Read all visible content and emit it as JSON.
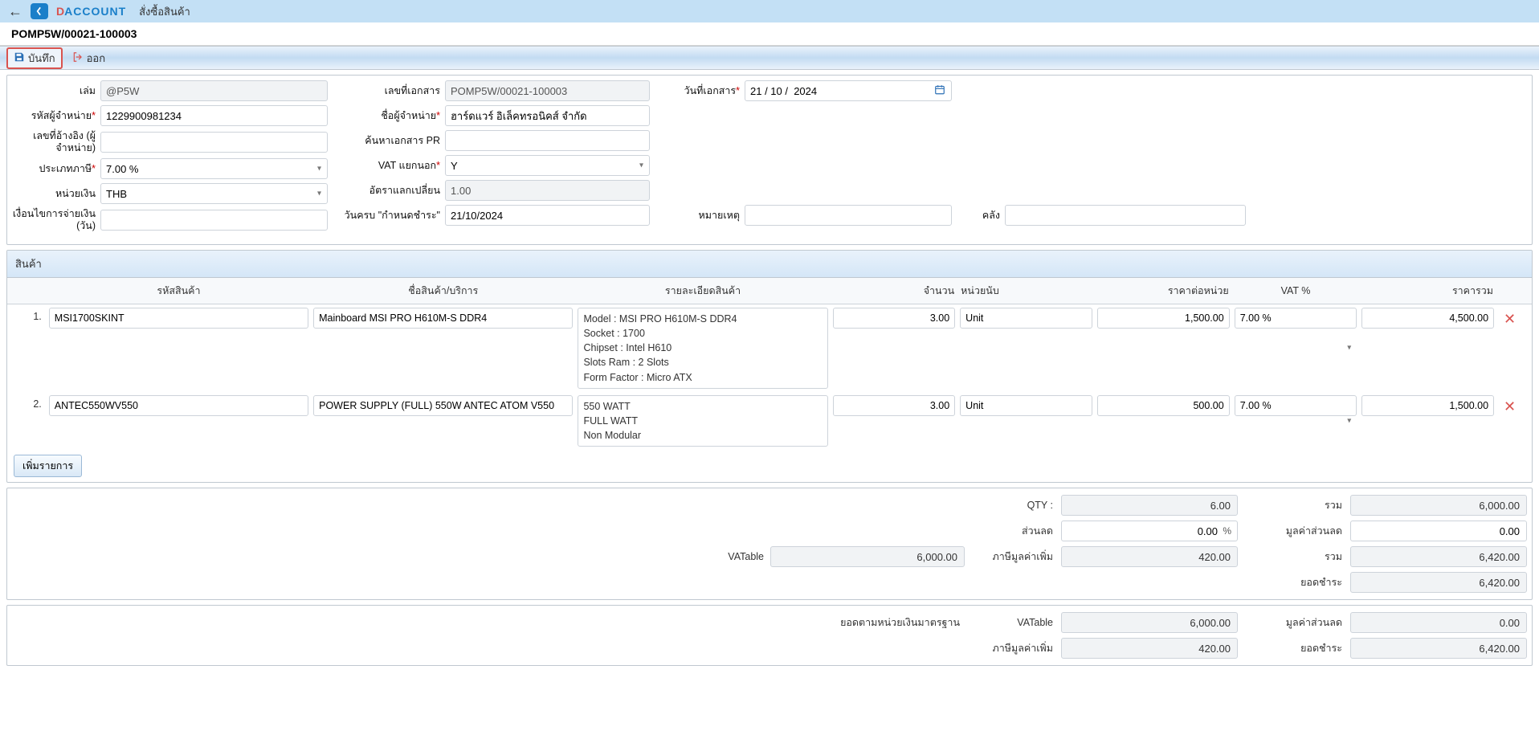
{
  "app": {
    "brand_d": "D",
    "brand_rest": "ACCOUNT",
    "page_title": "สั่งซื้อสินค้า",
    "doc_no": "POMP5W/00021-100003"
  },
  "toolbar": {
    "save_label": "บันทึก",
    "exit_label": "ออก"
  },
  "form": {
    "book_label": "เล่ม",
    "book_value": "@P5W",
    "docno_label": "เลขที่เอกสาร",
    "docno_value": "POMP5W/00021-100003",
    "docdate_label": "วันที่เอกสาร",
    "docdate_value": "21 / 10 /  2024",
    "vendor_code_label": "รหัสผู้จำหน่าย",
    "vendor_code_value": "1229900981234",
    "vendor_name_label": "ชื่อผู้จำหน่าย",
    "vendor_name_value": "ฮาร์ดแวร์ อิเล็คทรอนิคส์ จำกัด",
    "ref_label": "เลขที่อ้างอิง (ผู้จำหน่าย)",
    "ref_value": "",
    "pr_search_label": "ค้นหาเอกสาร PR",
    "pr_search_value": "",
    "tax_type_label": "ประเภทภาษี",
    "tax_type_value": "7.00 %",
    "vat_sep_label": "VAT แยกนอก",
    "vat_sep_value": "Y",
    "currency_label": "หน่วยเงิน",
    "currency_value": "THB",
    "rate_label": "อัตราแลกเปลี่ยน",
    "rate_value": "1.00",
    "terms_label": "เงื่อนไขการจ่ายเงิน (วัน)",
    "terms_value": "",
    "due_label": "วันครบ \"กำหนดชำระ\"",
    "due_value": "21/10/2024",
    "remark_label": "หมายเหตุ",
    "remark_value": "",
    "wh_label": "คลัง",
    "wh_value": ""
  },
  "items": {
    "section_title": "สินค้า",
    "add_label": "เพิ่มรายการ",
    "headers": {
      "code": "รหัสสินค้า",
      "name": "ชื่อสินค้า/บริการ",
      "detail": "รายละเอียดสินค้า",
      "qty": "จำนวน",
      "unit": "หน่วยนับ",
      "price": "ราคาต่อหน่วย",
      "vat": "VAT %",
      "amount": "ราคารวม"
    },
    "rows": [
      {
        "no": "1.",
        "code": "MSI1700SKINT",
        "name": "Mainboard MSI PRO H610M-S DDR4",
        "detail": "Model : MSI PRO H610M-S DDR4\nSocket : 1700\nChipset : Intel H610\nSlots Ram : 2 Slots\nForm Factor : Micro ATX",
        "qty": "3.00",
        "unit": "Unit",
        "price": "1,500.00",
        "vat": "7.00 %",
        "amount": "4,500.00"
      },
      {
        "no": "2.",
        "code": "ANTEC550WV550",
        "name": "POWER SUPPLY (FULL) 550W ANTEC ATOM V550",
        "detail": "550 WATT\nFULL WATT\nNon Modular",
        "qty": "3.00",
        "unit": "Unit",
        "price": "500.00",
        "vat": "7.00 %",
        "amount": "1,500.00"
      }
    ]
  },
  "totals": {
    "qty_label": "QTY :",
    "qty_value": "6.00",
    "sum_label": "รวม",
    "sum_value": "6,000.00",
    "discount_label": "ส่วนลด",
    "discount_value": "0.00",
    "discount_amt_label": "มูลค่าส่วนลด",
    "discount_amt_value": "0.00",
    "vatable_label": "VATable",
    "vatable_value": "6,000.00",
    "vat_amt_label": "ภาษีมูลค่าเพิ่ม",
    "vat_amt_value": "420.00",
    "total2_label": "รวม",
    "total2_value": "6,420.00",
    "balance_label": "ยอดชำระ",
    "balance_value": "6,420.00"
  },
  "std": {
    "title": "ยอดตามหน่วยเงินมาตรฐาน",
    "vatable_label": "VATable",
    "vatable_value": "6,000.00",
    "discount_amt_label": "มูลค่าส่วนลด",
    "discount_amt_value": "0.00",
    "vat_amt_label": "ภาษีมูลค่าเพิ่ม",
    "vat_amt_value": "420.00",
    "balance_label": "ยอดชำระ",
    "balance_value": "6,420.00"
  }
}
